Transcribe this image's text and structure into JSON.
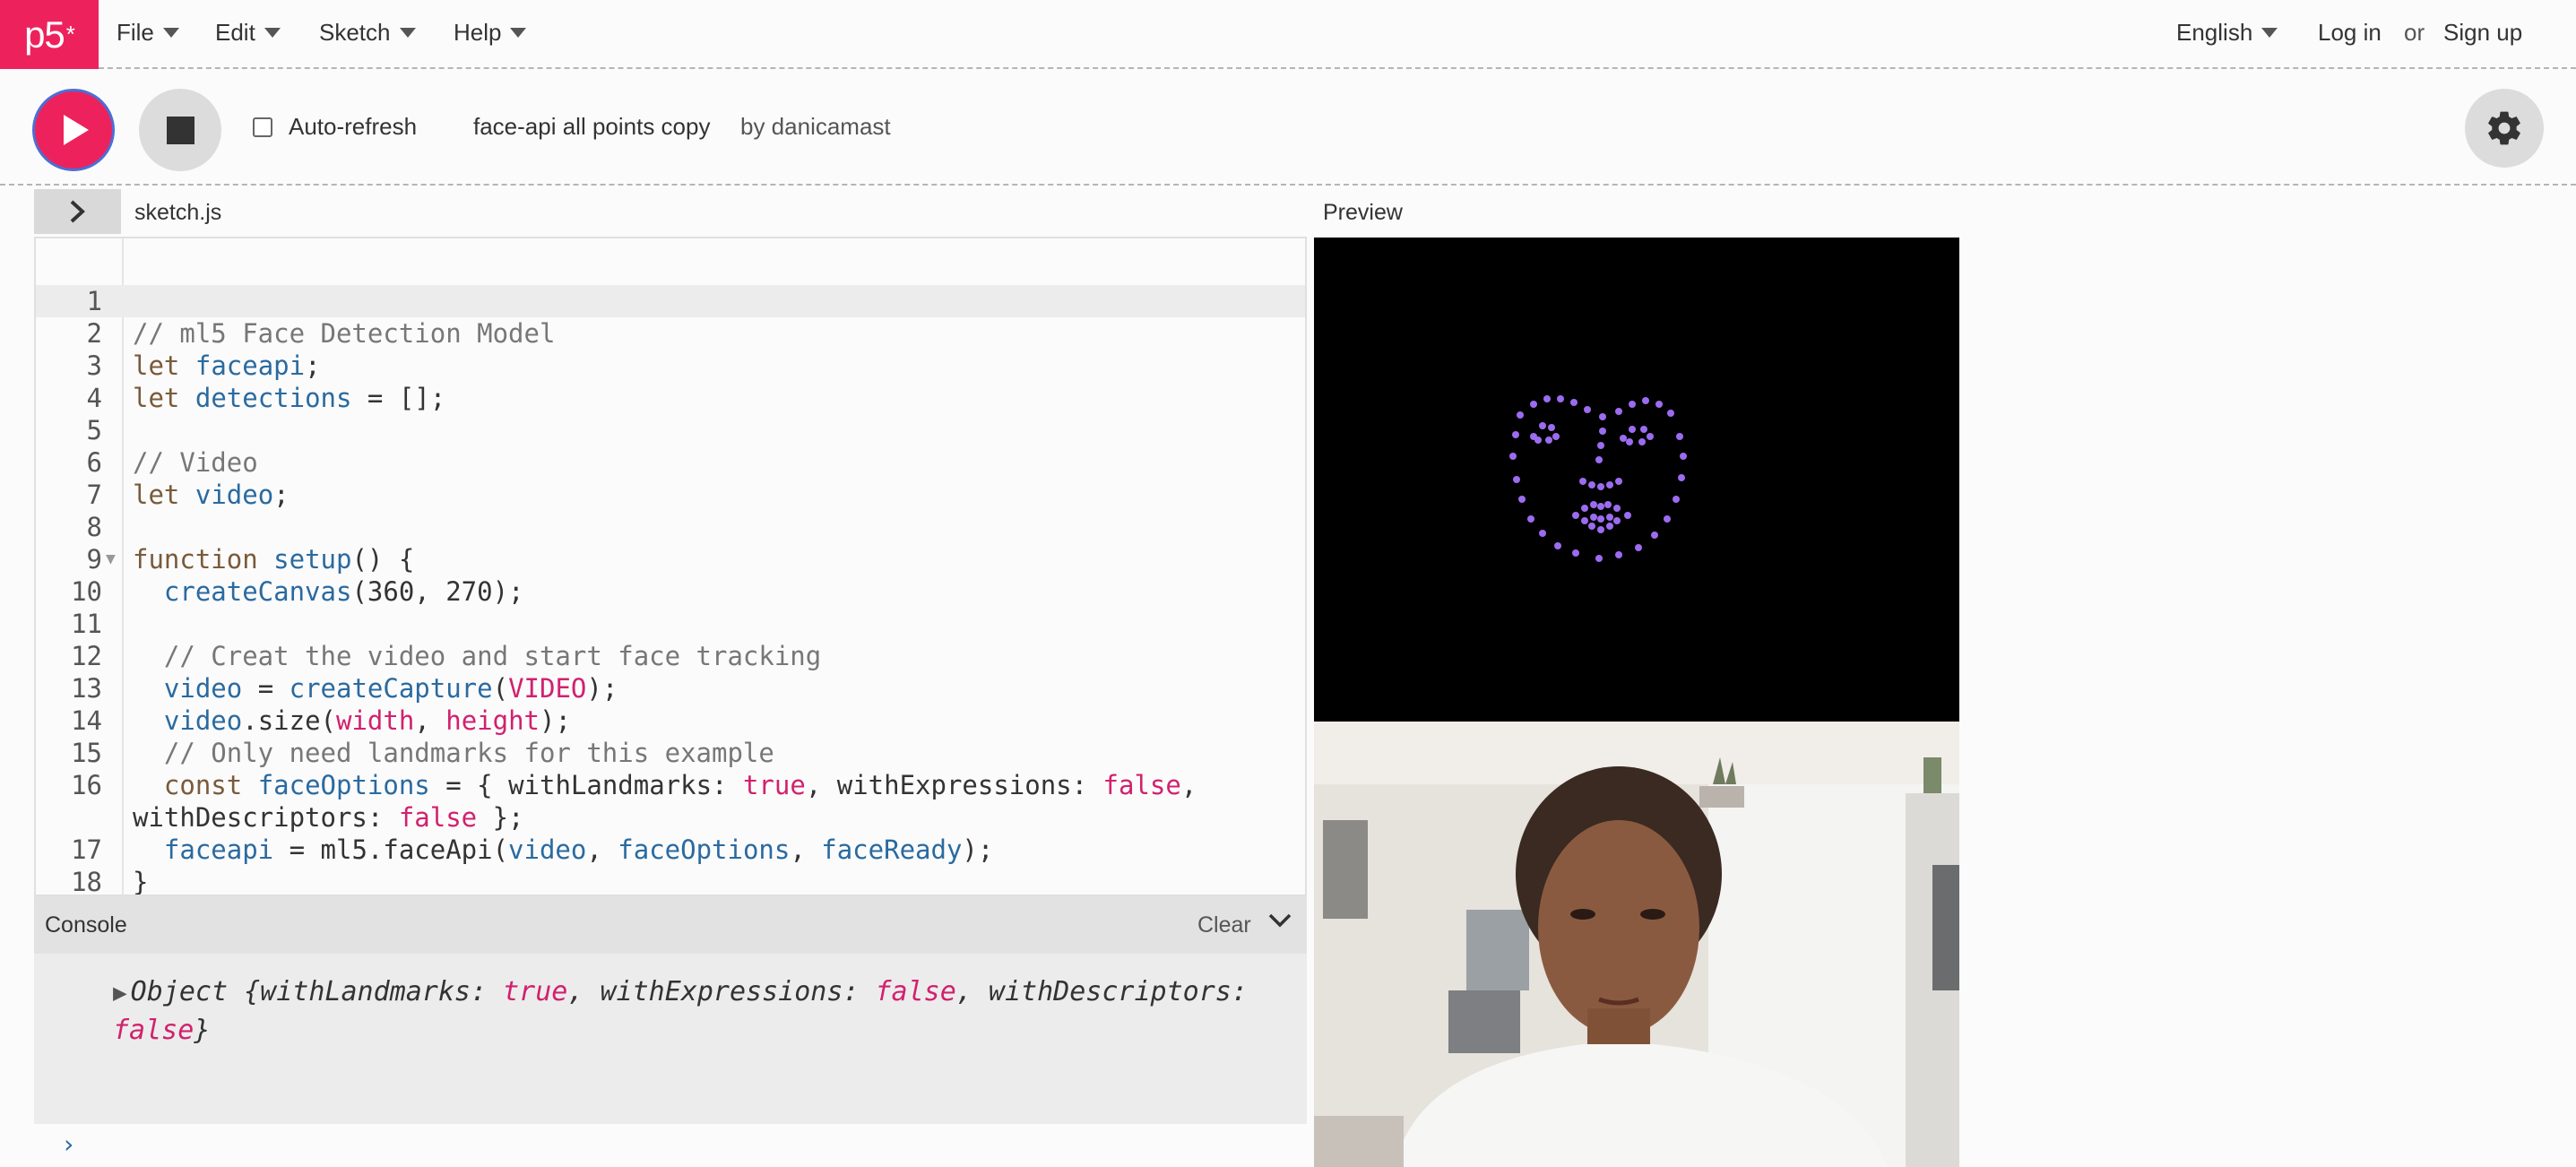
{
  "nav": {
    "logo": "p5",
    "logo_sup": "*",
    "menus": [
      "File",
      "Edit",
      "Sketch",
      "Help"
    ],
    "language": "English",
    "login": "Log in",
    "or": "or",
    "signup": "Sign up"
  },
  "toolbar": {
    "auto_refresh_label": "Auto-refresh",
    "auto_refresh_checked": false,
    "sketch_name": "face-api all points copy",
    "author": "by danicamast"
  },
  "editor": {
    "file_tab": "sketch.js",
    "lines": [
      {
        "n": "1",
        "text": ""
      },
      {
        "n": "2",
        "text": "// ml5 Face Detection Model"
      },
      {
        "n": "3",
        "text": "let faceapi;"
      },
      {
        "n": "4",
        "text": "let detections = [];"
      },
      {
        "n": "5",
        "text": ""
      },
      {
        "n": "6",
        "text": "// Video"
      },
      {
        "n": "7",
        "text": "let video;"
      },
      {
        "n": "8",
        "text": ""
      },
      {
        "n": "9",
        "text": "function setup() {"
      },
      {
        "n": "10",
        "text": "  createCanvas(360, 270);"
      },
      {
        "n": "11",
        "text": ""
      },
      {
        "n": "12",
        "text": "  // Creat the video and start face tracking"
      },
      {
        "n": "13",
        "text": "  video = createCapture(VIDEO);"
      },
      {
        "n": "14",
        "text": "  video.size(width, height);"
      },
      {
        "n": "15",
        "text": "  // Only need landmarks for this example"
      },
      {
        "n": "16",
        "text": "  const faceOptions = { withLandmarks: true, withExpressions: false, withDescriptors: false };"
      },
      {
        "n": "17",
        "text": "  faceapi = ml5.faceApi(video, faceOptions, faceReady);"
      },
      {
        "n": "18",
        "text": "}"
      }
    ]
  },
  "preview": {
    "label": "Preview",
    "dot_color": "#9b6cf0"
  },
  "console": {
    "title": "Console",
    "clear_label": "Clear",
    "message": "Object {withLandmarks: true, withExpressions: false, withDescriptors: false}",
    "prompt": "›"
  },
  "colors": {
    "brand": "#ed225d",
    "keyword_pink": "#d1216e",
    "identifier_blue": "#2a6aa0"
  }
}
